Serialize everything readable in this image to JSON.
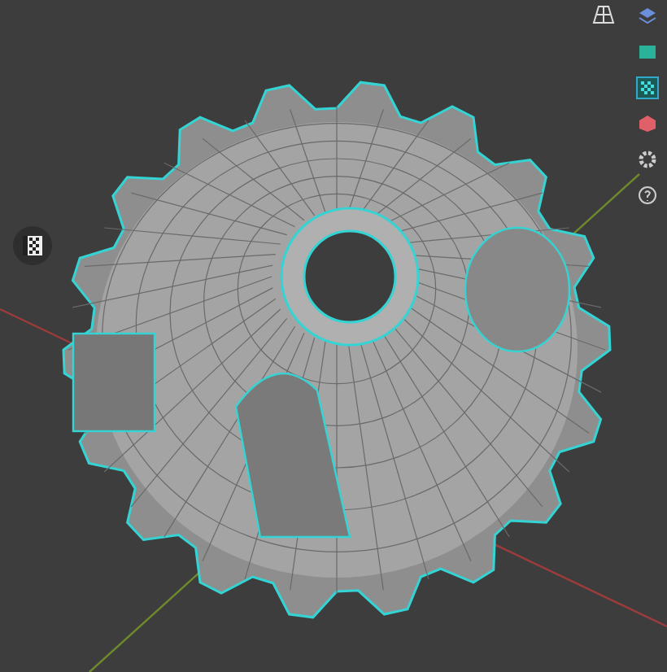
{
  "axes": [
    {
      "color": "#9c3c3c"
    },
    {
      "color": "#6e8a2c"
    }
  ]
}
